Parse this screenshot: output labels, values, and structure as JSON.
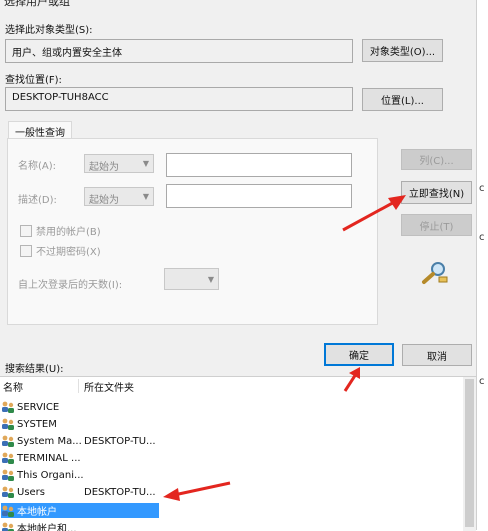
{
  "title_fragment": "选择用户或组",
  "object_type": {
    "label": "选择此对象类型(S):",
    "value": "用户、组或内置安全主体",
    "button": "对象类型(O)..."
  },
  "location": {
    "label": "查找位置(F):",
    "value": "DESKTOP-TUH8ACC",
    "button": "位置(L)..."
  },
  "tab": {
    "label": "一般性查询"
  },
  "query": {
    "name_label": "名称(A):",
    "name_op": "起始为",
    "desc_label": "描述(D):",
    "desc_op": "起始为",
    "disabled_accounts": "禁用的帐户(B)",
    "no_expire_pwd": "不过期密码(X)",
    "days_label": "自上次登录后的天数(I):"
  },
  "side_buttons": {
    "columns": "列(C)...",
    "find_now": "立即查找(N)",
    "stop": "停止(T)"
  },
  "search_results_label": "搜索结果(U):",
  "ok": "确定",
  "cancel": "取消",
  "results": {
    "columns": [
      "名称",
      "所在文件夹"
    ],
    "rows": [
      {
        "name": "SERVICE",
        "folder": ""
      },
      {
        "name": "SYSTEM",
        "folder": ""
      },
      {
        "name": "System Ma...",
        "folder": "DESKTOP-TU..."
      },
      {
        "name": "TERMINAL ...",
        "folder": ""
      },
      {
        "name": "This Organi...",
        "folder": ""
      },
      {
        "name": "Users",
        "folder": "DESKTOP-TU..."
      },
      {
        "name": "本地帐户",
        "folder": "",
        "selected": true
      },
      {
        "name": "本地帐户和...",
        "folder": ""
      }
    ]
  },
  "right_edge_text": [
    "c",
    "c",
    "c"
  ]
}
